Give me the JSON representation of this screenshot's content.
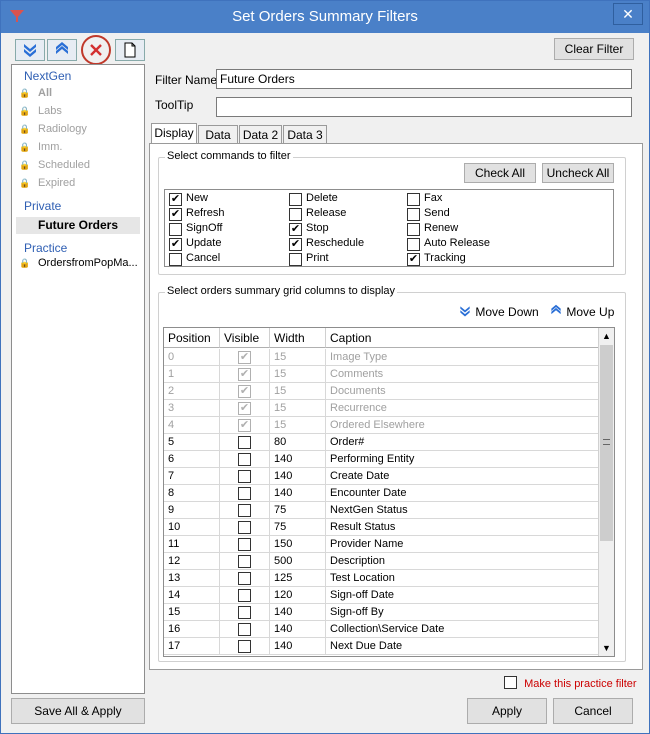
{
  "window": {
    "title": "Set Orders Summary Filters",
    "close_glyph": "✕"
  },
  "toolbar": {
    "clear_filter": "Clear Filter"
  },
  "sidebar": {
    "groups": [
      {
        "title": "NextGen",
        "items": [
          "All",
          "Labs",
          "Radiology",
          "Imm.",
          "Scheduled",
          "Expired"
        ]
      },
      {
        "title": "Private",
        "items": [
          "Future Orders"
        ]
      },
      {
        "title": "Practice",
        "items": [
          "OrdersfromPopMa..."
        ]
      }
    ],
    "save_all": "Save All & Apply"
  },
  "form": {
    "filter_name_label": "Filter Name",
    "filter_name_value": "Future Orders",
    "tooltip_label": "ToolTip",
    "tooltip_value": ""
  },
  "tabs": [
    "Display",
    "Data",
    "Data 2",
    "Data 3"
  ],
  "commands": {
    "title": "Select commands to filter",
    "check_all": "Check All",
    "uncheck_all": "Uncheck All",
    "items": [
      {
        "label": "New",
        "checked": true
      },
      {
        "label": "Refresh",
        "checked": true
      },
      {
        "label": "SignOff",
        "checked": false
      },
      {
        "label": "Update",
        "checked": true
      },
      {
        "label": "Cancel",
        "checked": false
      },
      {
        "label": "Delete",
        "checked": false
      },
      {
        "label": "Release",
        "checked": false
      },
      {
        "label": "Stop",
        "checked": true
      },
      {
        "label": "Reschedule",
        "checked": true
      },
      {
        "label": "Print",
        "checked": false
      },
      {
        "label": "Fax",
        "checked": false
      },
      {
        "label": "Send",
        "checked": false
      },
      {
        "label": "Renew",
        "checked": false
      },
      {
        "label": "Auto Release",
        "checked": false
      },
      {
        "label": "Tracking",
        "checked": true
      }
    ]
  },
  "columns": {
    "title": "Select orders summary grid columns to display",
    "move_down": "Move Down",
    "move_up": "Move Up",
    "headers": [
      "Position",
      "Visible",
      "Width",
      "Caption"
    ],
    "rows": [
      {
        "position": "0",
        "visible": true,
        "width": "15",
        "caption": "Image Type",
        "disabled": true
      },
      {
        "position": "1",
        "visible": true,
        "width": "15",
        "caption": "Comments",
        "disabled": true
      },
      {
        "position": "2",
        "visible": true,
        "width": "15",
        "caption": "Documents",
        "disabled": true
      },
      {
        "position": "3",
        "visible": true,
        "width": "15",
        "caption": "Recurrence",
        "disabled": true
      },
      {
        "position": "4",
        "visible": true,
        "width": "15",
        "caption": "Ordered Elsewhere",
        "disabled": true
      },
      {
        "position": "5",
        "visible": false,
        "width": "80",
        "caption": "Order#",
        "disabled": false
      },
      {
        "position": "6",
        "visible": false,
        "width": "140",
        "caption": "Performing Entity",
        "disabled": false
      },
      {
        "position": "7",
        "visible": false,
        "width": "140",
        "caption": "Create Date",
        "disabled": false
      },
      {
        "position": "8",
        "visible": false,
        "width": "140",
        "caption": "Encounter Date",
        "disabled": false
      },
      {
        "position": "9",
        "visible": false,
        "width": "75",
        "caption": "NextGen Status",
        "disabled": false
      },
      {
        "position": "10",
        "visible": false,
        "width": "75",
        "caption": "Result Status",
        "disabled": false
      },
      {
        "position": "11",
        "visible": false,
        "width": "150",
        "caption": "Provider Name",
        "disabled": false
      },
      {
        "position": "12",
        "visible": false,
        "width": "500",
        "caption": "Description",
        "disabled": false
      },
      {
        "position": "13",
        "visible": false,
        "width": "125",
        "caption": "Test Location",
        "disabled": false
      },
      {
        "position": "14",
        "visible": false,
        "width": "120",
        "caption": "Sign-off Date",
        "disabled": false
      },
      {
        "position": "15",
        "visible": false,
        "width": "140",
        "caption": "Sign-off By",
        "disabled": false
      },
      {
        "position": "16",
        "visible": false,
        "width": "140",
        "caption": "Collection\\Service Date",
        "disabled": false
      },
      {
        "position": "17",
        "visible": false,
        "width": "140",
        "caption": "Next Due Date",
        "disabled": false
      }
    ]
  },
  "footer": {
    "practice_filter_label": "Make this practice filter",
    "apply": "Apply",
    "cancel": "Cancel"
  },
  "colors": {
    "accent": "#4a80c8",
    "link": "#2f5fb3",
    "warning": "#cc0000"
  }
}
